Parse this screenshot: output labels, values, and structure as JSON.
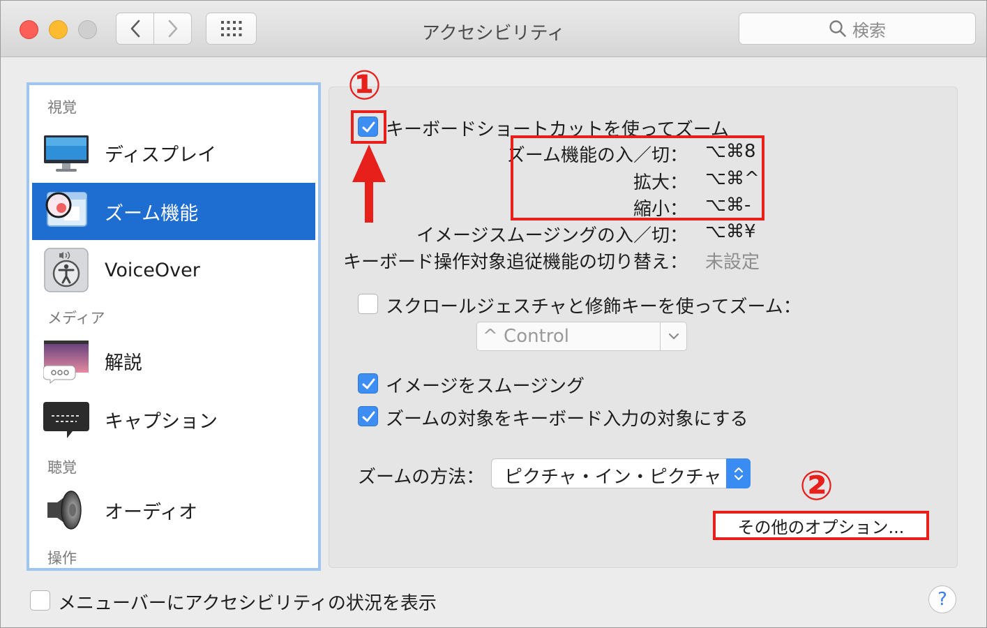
{
  "window": {
    "title": "アクセシビリティ"
  },
  "search": {
    "placeholder": "検索"
  },
  "sidebar": {
    "sections": [
      {
        "header": "視覚"
      },
      {
        "header": "メディア"
      },
      {
        "header": "聴覚"
      },
      {
        "header": "操作"
      }
    ],
    "items": [
      {
        "label": "ディスプレイ",
        "icon": "display-icon"
      },
      {
        "label": "ズーム機能",
        "icon": "zoom-icon",
        "selected": true
      },
      {
        "label": "VoiceOver",
        "icon": "voiceover-icon"
      },
      {
        "label": "解説",
        "icon": "descriptions-icon"
      },
      {
        "label": "キャプション",
        "icon": "captions-icon"
      },
      {
        "label": "オーディオ",
        "icon": "speaker-icon"
      }
    ]
  },
  "zoom": {
    "keyboard_shortcut": {
      "label": "キーボードショートカットを使ってズーム",
      "checked": true
    },
    "shortcuts": [
      {
        "label": "ズーム機能の入／切：",
        "keys": "⌥⌘8"
      },
      {
        "label": "拡大：",
        "keys": "⌥⌘^"
      },
      {
        "label": "縮小：",
        "keys": "⌥⌘-"
      },
      {
        "label": "イメージスムージングの入／切：",
        "keys": "⌥⌘¥"
      },
      {
        "label": "キーボード操作対象追従機能の切り替え：",
        "keys": "未設定"
      }
    ],
    "scroll_gesture": {
      "label": "スクロールジェスチャと修飾キーを使ってズーム：",
      "checked": false,
      "modifier": "^ Control"
    },
    "smooth_images": {
      "label": "イメージをスムージング",
      "checked": true
    },
    "follow_focus": {
      "label": "ズームの対象をキーボード入力の対象にする",
      "checked": true
    },
    "style": {
      "label": "ズームの方法：",
      "value": "ピクチャ・イン・ピクチャ"
    },
    "more_options": "その他のオプション..."
  },
  "footer": {
    "menubar_status": {
      "label": "メニューバーにアクセシビリティの状況を表示",
      "checked": false
    }
  },
  "annotations": {
    "step1": "①",
    "step2": "②",
    "color": "#e8201c"
  }
}
